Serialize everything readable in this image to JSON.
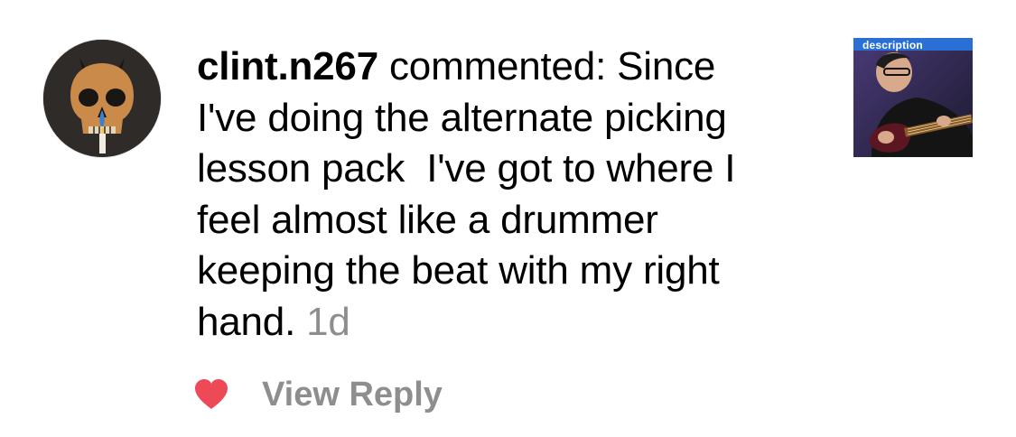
{
  "comment": {
    "username": "clint.n267",
    "action": "commented:",
    "lines": [
      "Since",
      "I've doing the alternate picking",
      "lesson pack  I've got to where I",
      "feel almost like a drummer",
      "keeping the beat with my right",
      "hand."
    ],
    "timestamp": "1d"
  },
  "avatar": {
    "icon": "skull-avatar-icon"
  },
  "thumbnail": {
    "label": "description"
  },
  "actions": {
    "like_icon": "heart-icon",
    "like_color": "#ed4956",
    "view_reply_label": "View Reply"
  },
  "colors": {
    "text": "#000000",
    "secondary": "#8e8e8e",
    "background": "#ffffff"
  }
}
